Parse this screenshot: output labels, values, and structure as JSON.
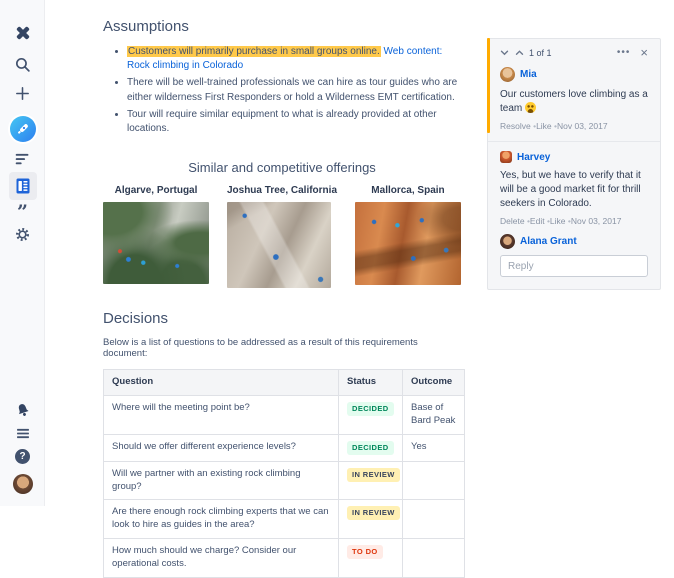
{
  "colors": {
    "accent_blue": "#0962D9",
    "highlight_yellow": "#FFC94A",
    "comment_anchor_yellow": "#FFAB00",
    "decided_bg": "#E3FCEF",
    "decided_text": "#00875A",
    "inreview_bg": "#FFF0B3",
    "inreview_text": "#38445C",
    "todo_bg": "#FFEBE6",
    "todo_text": "#DE350B"
  },
  "sidebar": {
    "icons": [
      "app-logo",
      "search",
      "create",
      "space-avatar",
      "activity",
      "pages",
      "quotes",
      "settings",
      "notifications",
      "menu",
      "help",
      "profile"
    ],
    "selected": "pages",
    "quotes_glyph": "”",
    "help_glyph": "?"
  },
  "main": {
    "assumptions": {
      "title": "Assumptions",
      "bullets": [
        {
          "highlight": "Customers will primarily purchase in small groups online.",
          "link": " Web content: Rock climbing in Colorado"
        },
        {
          "text": "There will be well-trained professionals we can hire as tour guides who are either wilderness First Responders or hold a Wilderness EMT certification."
        },
        {
          "text": "Tour will require similar equipment to what is already provided at other locations."
        }
      ]
    },
    "offerings": {
      "title": "Similar and competitive offerings",
      "items": [
        {
          "caption": "Algarve, Portugal",
          "image": "climbers-on-grey-cliff-with-greenery"
        },
        {
          "caption": "Joshua Tree, California",
          "image": "climbers-on-light-granite-rock"
        },
        {
          "caption": "Mallorca, Spain",
          "image": "climbers-on-orange-rock-face"
        }
      ]
    },
    "decisions": {
      "title": "Decisions",
      "intro": "Below is a list of questions to be addressed as a result of this requirements document:",
      "table": {
        "headers": [
          "Question",
          "Status",
          "Outcome"
        ],
        "rows": [
          {
            "question": "Where will the meeting point be?",
            "status": "DECIDED",
            "status_type": "decided",
            "outcome": "Base of Bard Peak"
          },
          {
            "question": "Should we offer different experience levels?",
            "status": "DECIDED",
            "status_type": "decided",
            "outcome": "Yes"
          },
          {
            "question": "Will we partner with an existing rock climbing group?",
            "status": "IN REVIEW",
            "status_type": "inreview",
            "outcome": ""
          },
          {
            "question": "Are there enough rock climbing experts that we can look to hire as guides in the area?",
            "status": "IN REVIEW",
            "status_type": "inreview",
            "outcome": ""
          },
          {
            "question": "How much should we charge? Consider our operational costs.",
            "status": "TO DO",
            "status_type": "todo",
            "outcome": ""
          }
        ]
      }
    }
  },
  "comments": {
    "pager": "1 of 1",
    "icons": {
      "more": "•••",
      "close": "×"
    },
    "items": [
      {
        "author": "Mia",
        "text": "Our customers love climbing as a team ",
        "emoji": "smiley-face",
        "actions": [
          "Resolve",
          "Like"
        ],
        "date": "Nov 03, 2017"
      },
      {
        "author": "Harvey",
        "text": "Yes, but we have to verify that it will be a good market fit for thrill seekers in Colorado.",
        "actions": [
          "Delete",
          "Edit",
          "Like"
        ],
        "date": "Nov 03, 2017"
      }
    ],
    "reply": {
      "author": "Alana Grant",
      "placeholder": "Reply"
    }
  }
}
